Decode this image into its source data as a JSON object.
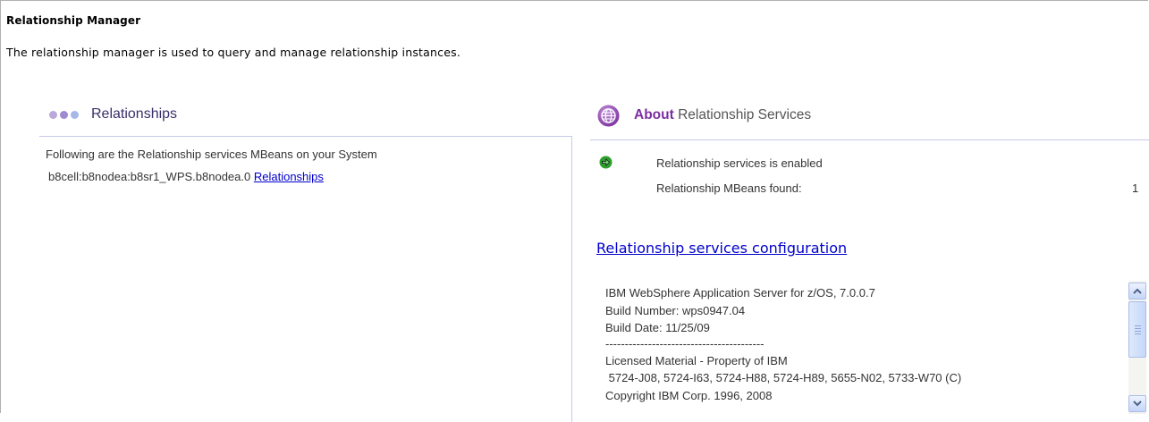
{
  "page": {
    "title": "Relationship Manager",
    "description": "The relationship manager is used to query and manage relationship instances."
  },
  "relationships_panel": {
    "title": "Relationships",
    "intro": "Following are the Relationship services MBeans on your System",
    "mbean_name": "b8cell:b8nodea:b8sr1_WPS.b8nodea.0",
    "mbean_link": "Relationships",
    "dot_colors": [
      "#b9a9dc",
      "#9d8bd0",
      "#a6b8e8"
    ]
  },
  "about_panel": {
    "title_bold": "About",
    "title_rest": " Relationship Services",
    "status_text": "Relationship services is enabled",
    "mbeans_label": "Relationship MBeans found:",
    "mbeans_count": "1",
    "config_link": "Relationship services configuration",
    "info_lines": [
      "IBM WebSphere Application Server for z/OS, 7.0.0.7",
      "Build Number: wps0947.04",
      "Build Date: 11/25/09",
      "-----------------------------------------",
      "Licensed Material - Property of IBM",
      " 5724-J08, 5724-I63, 5724-H88, 5724-H89, 5655-N02, 5733-W70 (C)",
      "Copyright IBM Corp. 1996, 2008"
    ]
  },
  "icons": {
    "globe": "globe-icon",
    "status": "green-arrow-icon",
    "scroll_up": "scroll-up-icon",
    "scroll_down": "scroll-down-icon"
  },
  "colors": {
    "accent_purple": "#7b2fa0",
    "link_blue": "#0000cc",
    "panel_border": "#c5c9e8",
    "status_green": "#2e9e2e"
  }
}
